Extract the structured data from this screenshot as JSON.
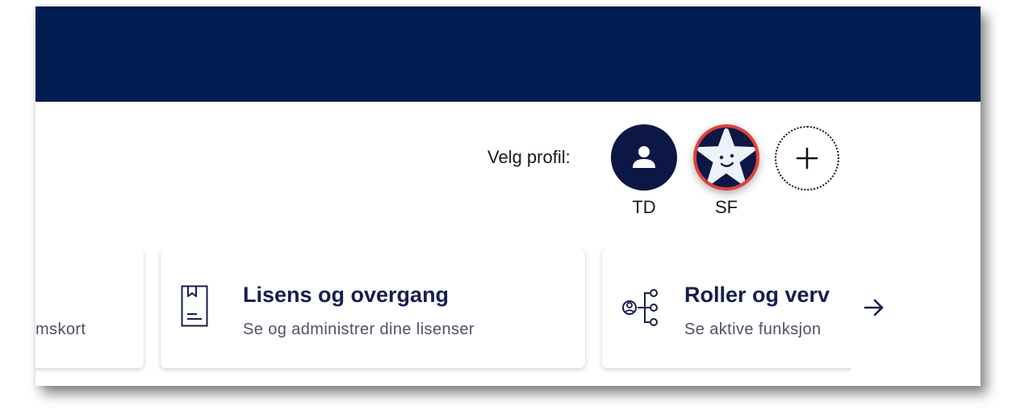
{
  "profile": {
    "label": "Velg profil:",
    "profiles": [
      {
        "initials": "TD",
        "icon": "person-icon"
      },
      {
        "initials": "SF",
        "icon": "star-face-icon",
        "selected": true
      }
    ],
    "add_icon": "plus-icon"
  },
  "cards": [
    {
      "title": "",
      "subtitle": "mskort"
    },
    {
      "title": "Lisens og overgang",
      "subtitle": "Se og administrer dine lisenser",
      "icon": "license-document-icon"
    },
    {
      "title": "Roller og verv",
      "subtitle": "Se aktive funksjon",
      "icon": "roles-hierarchy-icon"
    }
  ],
  "navigation": {
    "next_icon": "arrow-right-icon"
  },
  "colors": {
    "header": "#001c52",
    "title": "#141e50",
    "avatar_bg": "#0d1746",
    "selected_ring": "#e0403a"
  }
}
